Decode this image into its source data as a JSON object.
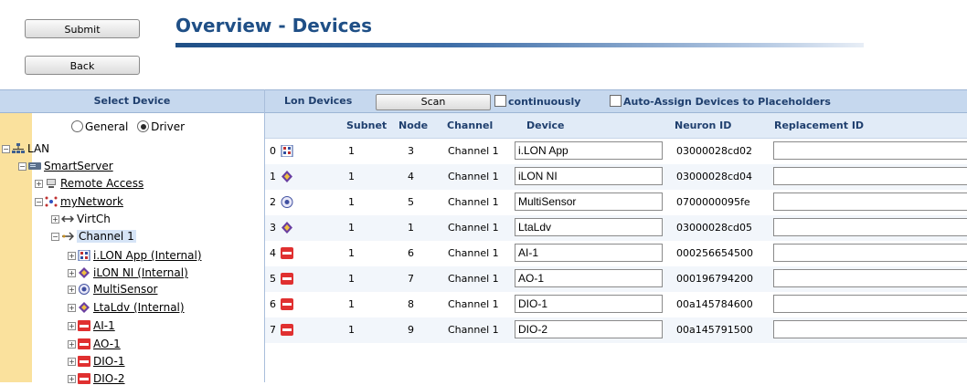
{
  "header": {
    "submit_label": "Submit",
    "back_label": "Back",
    "title": "Overview - Devices"
  },
  "left": {
    "header": "Select Device",
    "mode_options": [
      "General",
      "Driver"
    ],
    "mode_selected": "Driver",
    "tree": {
      "lan": "LAN",
      "smartserver": "SmartServer",
      "remote_access": "Remote Access",
      "mynetwork": "myNetwork",
      "virtch": "VirtCh",
      "channel1": "Channel 1",
      "devices": [
        "i.LON App (Internal)",
        "iLON NI (Internal)",
        "MultiSensor",
        "LtaLdv (Internal)",
        "AI-1",
        "AO-1",
        "DIO-1",
        "DIO-2"
      ]
    }
  },
  "right": {
    "title": "Lon Devices",
    "scan_label": "Scan",
    "continuously_label": "continuously",
    "auto_assign_label": "Auto-Assign Devices to Placeholders",
    "columns": {
      "subnet": "Subnet",
      "node": "Node",
      "channel": "Channel",
      "device": "Device",
      "neuron_id": "Neuron ID",
      "replacement_id": "Replacement ID"
    },
    "rows": [
      {
        "index": "0",
        "subnet": "1",
        "node": "3",
        "channel": "Channel 1",
        "device": "i.LON App",
        "neuron_id": "03000028cd02",
        "replacement_id": ""
      },
      {
        "index": "1",
        "subnet": "1",
        "node": "4",
        "channel": "Channel 1",
        "device": "iLON NI",
        "neuron_id": "03000028cd04",
        "replacement_id": ""
      },
      {
        "index": "2",
        "subnet": "1",
        "node": "5",
        "channel": "Channel 1",
        "device": "MultiSensor",
        "neuron_id": "0700000095fe",
        "replacement_id": ""
      },
      {
        "index": "3",
        "subnet": "1",
        "node": "1",
        "channel": "Channel 1",
        "device": "LtaLdv",
        "neuron_id": "03000028cd05",
        "replacement_id": ""
      },
      {
        "index": "4",
        "subnet": "1",
        "node": "6",
        "channel": "Channel 1",
        "device": "AI-1",
        "neuron_id": "000256654500",
        "replacement_id": ""
      },
      {
        "index": "5",
        "subnet": "1",
        "node": "7",
        "channel": "Channel 1",
        "device": "AO-1",
        "neuron_id": "000196794200",
        "replacement_id": ""
      },
      {
        "index": "6",
        "subnet": "1",
        "node": "8",
        "channel": "Channel 1",
        "device": "DIO-1",
        "neuron_id": "00a145784600",
        "replacement_id": ""
      },
      {
        "index": "7",
        "subnet": "1",
        "node": "9",
        "channel": "Channel 1",
        "device": "DIO-2",
        "neuron_id": "00a145791500",
        "replacement_id": ""
      }
    ]
  },
  "icons": {
    "rows": [
      "app-icon",
      "diamond-device-icon",
      "sensor-icon",
      "diamond-device-icon",
      "red-block-icon",
      "red-block-icon",
      "red-block-icon",
      "red-block-icon"
    ]
  },
  "colors": {
    "title": "#1f4f86",
    "panel_header": "#c6d8ee",
    "left_strip": "#fae19d",
    "device_red": "#e03030"
  }
}
